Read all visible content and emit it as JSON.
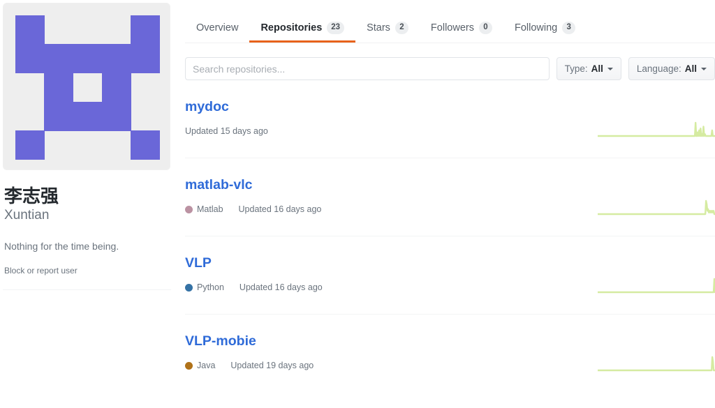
{
  "profile": {
    "avatar_alt": "identicon-avatar",
    "avatar_bg": "#eeeeee",
    "avatar_fg": "#6a67d8",
    "identicon_grid": [
      [
        1,
        0,
        0,
        0,
        1
      ],
      [
        1,
        1,
        1,
        1,
        1
      ],
      [
        0,
        1,
        0,
        1,
        0
      ],
      [
        0,
        1,
        1,
        1,
        0
      ],
      [
        1,
        0,
        0,
        0,
        1
      ]
    ],
    "name": "李志强",
    "login": "Xuntian",
    "bio": "Nothing for the time being.",
    "block_or_report": "Block or report user"
  },
  "tabs": [
    {
      "label": "Overview",
      "count": null,
      "active": false
    },
    {
      "label": "Repositories",
      "count": "23",
      "active": true
    },
    {
      "label": "Stars",
      "count": "2",
      "active": false
    },
    {
      "label": "Followers",
      "count": "0",
      "active": false
    },
    {
      "label": "Following",
      "count": "3",
      "active": false
    }
  ],
  "search": {
    "placeholder": "Search repositories...",
    "value": ""
  },
  "filters": [
    {
      "name": "type-filter",
      "label": "Type:",
      "value": "All"
    },
    {
      "name": "language-filter",
      "label": "Language:",
      "value": "All"
    }
  ],
  "repositories": [
    {
      "name": "mydoc",
      "language": null,
      "language_color": null,
      "updated": "Updated 15 days ago",
      "sparkline_color": "#d5eba1",
      "sparkline": [
        0,
        0,
        0,
        0,
        0,
        0,
        0,
        0,
        0,
        0,
        0,
        0,
        0,
        0,
        0,
        0,
        0,
        0,
        0,
        0,
        0,
        0,
        0,
        0,
        0,
        0,
        0,
        0,
        0,
        0,
        0,
        0,
        0,
        0,
        0,
        0,
        0,
        0,
        0,
        0,
        0,
        0,
        0,
        0,
        0,
        0,
        0,
        0,
        0,
        0,
        0,
        0,
        0,
        0,
        0,
        0,
        0,
        0,
        0,
        0,
        0,
        0,
        0,
        0,
        0,
        0,
        0,
        0,
        0,
        0,
        0,
        0,
        0,
        0,
        0,
        0,
        0,
        0,
        0,
        0,
        0,
        0,
        0,
        0,
        0,
        0,
        0,
        0,
        0,
        0,
        0,
        0,
        0,
        0,
        0,
        0,
        0,
        0,
        0,
        0,
        0,
        0,
        0,
        0,
        0,
        0,
        0,
        0,
        0,
        0,
        0,
        0,
        0,
        0,
        0,
        0,
        0,
        0,
        0,
        0,
        0,
        0,
        0,
        0,
        0,
        0,
        0,
        0,
        0,
        0,
        0,
        0,
        0,
        0,
        0,
        0,
        7,
        0,
        0,
        2,
        0,
        3,
        0,
        4,
        0,
        1,
        0,
        5,
        0,
        1,
        0,
        0,
        0,
        0,
        0,
        0,
        0,
        0,
        0,
        3,
        0,
        0,
        0,
        0
      ]
    },
    {
      "name": "matlab-vlc",
      "language": "Matlab",
      "language_color": "#bb92a2",
      "updated": "Updated 16 days ago",
      "sparkline_color": "#d5eba1",
      "sparkline": [
        0,
        0,
        0,
        0,
        0,
        0,
        0,
        0,
        0,
        0,
        0,
        0,
        0,
        0,
        0,
        0,
        0,
        0,
        0,
        0,
        0,
        0,
        0,
        0,
        0,
        0,
        0,
        0,
        0,
        0,
        0,
        0,
        0,
        0,
        0,
        0,
        0,
        0,
        0,
        0,
        0,
        0,
        0,
        0,
        0,
        0,
        0,
        0,
        0,
        0,
        0,
        0,
        0,
        0,
        0,
        0,
        0,
        0,
        0,
        0,
        0,
        0,
        0,
        0,
        0,
        0,
        0,
        0,
        0,
        0,
        0,
        0,
        0,
        0,
        0,
        0,
        0,
        0,
        0,
        0,
        0,
        0,
        0,
        0,
        0,
        0,
        0,
        0,
        0,
        0,
        0,
        0,
        0,
        0,
        0,
        0,
        0,
        0,
        0,
        0,
        0,
        0,
        0,
        0,
        0,
        0,
        0,
        0,
        0,
        0,
        0,
        0,
        0,
        0,
        0,
        0,
        0,
        0,
        0,
        0,
        0,
        0,
        0,
        0,
        0,
        0,
        0,
        0,
        0,
        0,
        0,
        0,
        0,
        0,
        0,
        0,
        0,
        0,
        0,
        0,
        0,
        0,
        0,
        0,
        0,
        0,
        0,
        0,
        0,
        0,
        0,
        0,
        0,
        0,
        0,
        0,
        0,
        8,
        6,
        2,
        3,
        1,
        2,
        1,
        2,
        1,
        2,
        1,
        2,
        0,
        0
      ]
    },
    {
      "name": "VLP",
      "language": "Python",
      "language_color": "#3572a5",
      "updated": "Updated 16 days ago",
      "sparkline_color": "#d5eba1",
      "sparkline": [
        0,
        0,
        0,
        0,
        0,
        0,
        0,
        0,
        0,
        0,
        0,
        0,
        0,
        0,
        0,
        0,
        0,
        0,
        0,
        0,
        0,
        0,
        0,
        0,
        0,
        0,
        0,
        0,
        0,
        0,
        0,
        0,
        0,
        0,
        0,
        0,
        0,
        0,
        0,
        0,
        0,
        0,
        0,
        0,
        0,
        0,
        0,
        0,
        0,
        0,
        0,
        0,
        0,
        0,
        0,
        0,
        0,
        0,
        0,
        0,
        0,
        0,
        0,
        0,
        0,
        0,
        0,
        0,
        0,
        0,
        0,
        0,
        0,
        0,
        0,
        0,
        0,
        0,
        0,
        0,
        0,
        0,
        0,
        0,
        0,
        0,
        0,
        0,
        0,
        0,
        0,
        0,
        0,
        0,
        0,
        0,
        0,
        0,
        0,
        0,
        0,
        0,
        0,
        0,
        0,
        0,
        0,
        0,
        0,
        0,
        0,
        0,
        0,
        0,
        0,
        0,
        0,
        0,
        0,
        0,
        0,
        0,
        0,
        0,
        0,
        0,
        0,
        0,
        0,
        0,
        0,
        0,
        0,
        0,
        0,
        0,
        0,
        0,
        0,
        0,
        0,
        0,
        0,
        0,
        0,
        0,
        0,
        0,
        0,
        0,
        0,
        0,
        0,
        0,
        0,
        0,
        0,
        0,
        0,
        0,
        0,
        0,
        0,
        0,
        0,
        0,
        0,
        0,
        0,
        7,
        0
      ]
    },
    {
      "name": "VLP-mobie",
      "language": "Java",
      "language_color": "#b07219",
      "updated": "Updated 19 days ago",
      "sparkline_color": "#d5eba1",
      "sparkline": [
        0,
        0,
        0,
        0,
        0,
        0,
        0,
        0,
        0,
        0,
        0,
        0,
        0,
        0,
        0,
        0,
        0,
        0,
        0,
        0,
        0,
        0,
        0,
        0,
        0,
        0,
        0,
        0,
        0,
        0,
        0,
        0,
        0,
        0,
        0,
        0,
        0,
        0,
        0,
        0,
        0,
        0,
        0,
        0,
        0,
        0,
        0,
        0,
        0,
        0,
        0,
        0,
        0,
        0,
        0,
        0,
        0,
        0,
        0,
        0,
        0,
        0,
        0,
        0,
        0,
        0,
        0,
        0,
        0,
        0,
        0,
        0,
        0,
        0,
        0,
        0,
        0,
        0,
        0,
        0,
        0,
        0,
        0,
        0,
        0,
        0,
        0,
        0,
        0,
        0,
        0,
        0,
        0,
        0,
        0,
        0,
        0,
        0,
        0,
        0,
        0,
        0,
        0,
        0,
        0,
        0,
        0,
        0,
        0,
        0,
        0,
        0,
        0,
        0,
        0,
        0,
        0,
        0,
        0,
        0,
        0,
        0,
        0,
        0,
        0,
        0,
        0,
        0,
        0,
        0,
        0,
        0,
        0,
        0,
        0,
        0,
        0,
        0,
        0,
        0,
        0,
        0,
        0,
        0,
        0,
        0,
        0,
        0,
        0,
        0,
        0,
        0,
        0,
        0,
        0,
        0,
        0,
        0,
        0,
        0,
        0,
        0,
        0,
        0,
        0,
        0,
        0,
        0,
        0,
        0,
        3,
        2,
        0,
        0,
        0
      ]
    }
  ]
}
